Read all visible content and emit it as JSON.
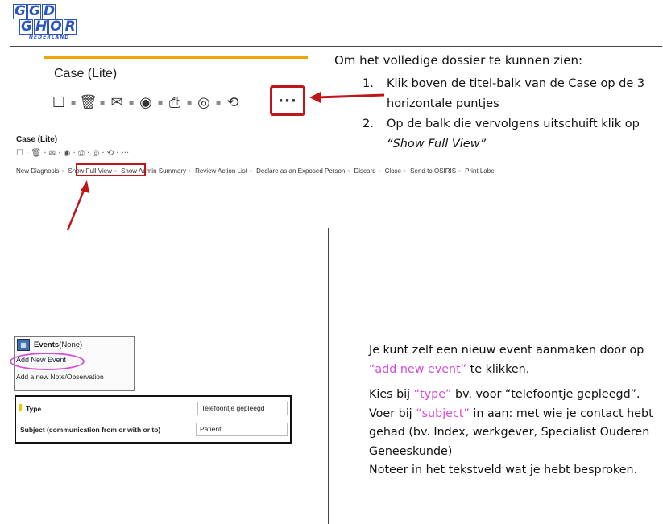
{
  "logo": {
    "row1": [
      "G",
      "G",
      "D"
    ],
    "row2": [
      "G",
      "H",
      "O",
      "R"
    ],
    "sub": "NEDERLAND",
    "color": "#2a55c2"
  },
  "case_panel": {
    "title": "Case (Lite)",
    "toolbar_icons": [
      "bookmark-icon",
      "trash-icon",
      "mail-icon",
      "eye-icon",
      "print-icon",
      "record-icon",
      "history-icon"
    ],
    "toolbar_glyphs": [
      "☐",
      "🗑",
      "✉",
      "◉",
      "⎙",
      "◎",
      "⟲"
    ],
    "more_label": "···",
    "small_title": "Case (Lite)",
    "small_toolbar": "☐ · 🗑 · ✉ · ◉ · ⎙ · ◎ · ⟲ · ···",
    "actions": [
      "New Diagnosis",
      "Show Full View",
      "Show Admin Summary",
      "Review Action List",
      "Declare as an Exposed Person",
      "Discard",
      "Close",
      "Send to OSIRIS",
      "Print Label"
    ],
    "highlight_color": "#c0161a"
  },
  "instructions": {
    "heading": "Om het volledige dossier te kunnen zien:",
    "items": [
      {
        "num": "1.",
        "text": "Klik boven de titel-balk van de Case op de 3 horizontale puntjes"
      },
      {
        "num": "2.",
        "text_prefix": "Op de balk die vervolgens uitschuift klik op ",
        "text_italic": "“Show Full View”"
      }
    ]
  },
  "events_panel": {
    "heading_bold": "Events",
    "heading_rest": " (None)",
    "add_event": "Add New Event",
    "add_note": "Add a new Note/Observation",
    "form": {
      "type_label": "Type",
      "type_value": "Telefoontje gepleegd",
      "subject_label": "Subject (communication from or with or to)",
      "subject_value": "Patiënt"
    },
    "oval_color": "#d84ad8"
  },
  "events_text": {
    "p1_a": "Je kunt zelf een nieuw event aanmaken door op ",
    "p1_hl": "“add new event”",
    "p1_b": " te klikken.",
    "p2_a": "Kies bij ",
    "p2_hl": "“type”",
    "p2_b": " bv. voor “telefoontje gepleegd”.",
    "p3_a": "Voer bij ",
    "p3_hl": "“subject”",
    "p3_b": " in aan: met wie je contact hebt gehad (bv. Index, werkgever, Specialist Ouderen Geneeskunde)",
    "p4": "Noteer in het tekstveld wat je hebt besproken.",
    "accent": "#d84ad8"
  }
}
